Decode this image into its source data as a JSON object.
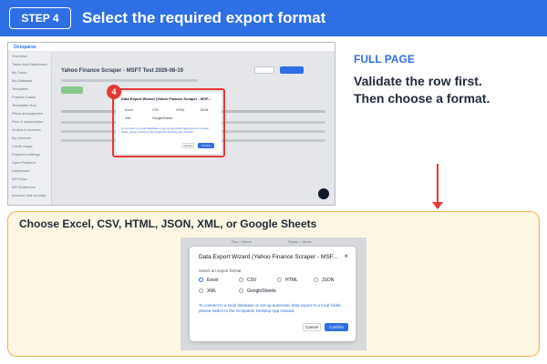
{
  "header": {
    "step_label": "STEP 4",
    "title": "Select the required export format"
  },
  "right_text": {
    "label": "FULL PAGE",
    "line1": "Validate the row first.",
    "line2": "Then choose a format."
  },
  "bottom": {
    "caption": "Choose Excel, CSV, HTML, JSON, XML, or Google Sheets"
  },
  "top_screenshot": {
    "app_name": "Octoparse",
    "page_title": "Yahoo Finance Scraper - MSFT Test 2026-08-19",
    "step_number": "4",
    "dialog": {
      "title": "Data Export Wizard (Yahoo Finance Scraper - MSF...",
      "options": [
        "Excel",
        "CSV",
        "HTML",
        "JSON",
        "XML",
        "GoogleSheets"
      ],
      "cancel": "Cancel",
      "confirm": "Confirm"
    },
    "sidebar": [
      "Overview",
      "Tasks and Dashboard",
      "My Tasks",
      "My Datasets",
      "Templates",
      "Popular Cases",
      "Templates Hub",
      "Plans and payment",
      "Plan & subscription",
      "Orders & invoices",
      "My Invoices",
      "Credit usage",
      "Payment settings",
      "Open Platform",
      "Dashboard",
      "API Keys",
      "API Reference",
      "Account and security",
      "Security Setting"
    ]
  },
  "dialog": {
    "title": "Data Export Wizard (Yahoo Finance Scraper - MSF...",
    "close_glyph": "×",
    "select_label": "Select an export format",
    "options": [
      "Excel",
      "CSV",
      "HTML",
      "JSON",
      "XML",
      "GoogleSheets"
    ],
    "selected": "Excel",
    "note": "To connect to a local database or set up automatic data export to a local folder, please switch to the Octoparse Desktop App instead.",
    "cancel": "Cancel",
    "confirm": "Confirm",
    "bg_tabs": [
      "Run > Items",
      "Pause > Items"
    ]
  },
  "colors": {
    "header_blue": "#2f6fe4",
    "highlight_red": "#e53935",
    "panel_border": "#f0b44c",
    "panel_bg": "#fdf6e3"
  }
}
